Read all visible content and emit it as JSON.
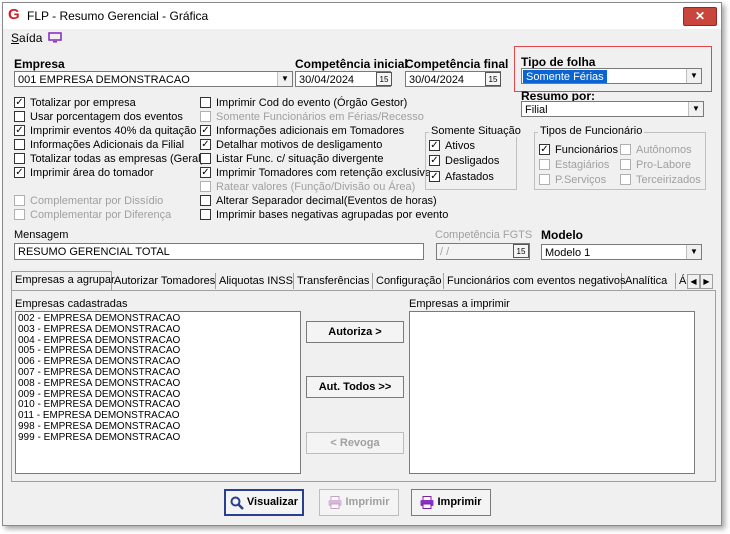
{
  "window": {
    "title": "FLP - Resumo Gerencial - Gráfica",
    "close_label": "✕"
  },
  "menu": {
    "saida_u": "S",
    "saida_rest": "aída"
  },
  "empresa": {
    "label": "Empresa",
    "value": "001 EMPRESA DEMONSTRACAO"
  },
  "competencia_inicial": {
    "label": "Competência inicial",
    "value": "30/04/2024"
  },
  "competencia_final": {
    "label": "Competência final",
    "value": "30/04/2024"
  },
  "calendar_btn": "15",
  "tipo_folha": {
    "label": "Tipo de folha",
    "value": "Somente Férias"
  },
  "resumo_por": {
    "label": "Resumo por:",
    "value": "Filial"
  },
  "checks_col1": [
    {
      "label": "Totalizar por empresa",
      "checked": true,
      "enabled": true
    },
    {
      "label": "Usar porcentagem dos eventos",
      "checked": false,
      "enabled": true
    },
    {
      "label": "Imprimir eventos 40% da quitação",
      "checked": true,
      "enabled": true
    },
    {
      "label": "Informações Adicionais da Filial",
      "checked": false,
      "enabled": true
    },
    {
      "label": "Totalizar todas as empresas (Geral)",
      "checked": false,
      "enabled": true
    },
    {
      "label": "Imprimir área do tomador",
      "checked": true,
      "enabled": true
    },
    {
      "label": "Complementar por Dissídio",
      "checked": false,
      "enabled": false
    },
    {
      "label": "Complementar por Diferença",
      "checked": false,
      "enabled": false
    }
  ],
  "checks_col2": [
    {
      "label": "Imprimir Cod do evento (Órgão Gestor)",
      "checked": false,
      "enabled": true
    },
    {
      "label": "Somente Funcionários em Férias/Recesso",
      "checked": false,
      "enabled": false
    },
    {
      "label": "Informações adicionais em Tomadores",
      "checked": true,
      "enabled": true
    },
    {
      "label": "Detalhar motivos de desligamento",
      "checked": true,
      "enabled": true
    },
    {
      "label": "Listar Func. c/ situação divergente",
      "checked": false,
      "enabled": true
    },
    {
      "label": "Imprimir Tomadores com retenção exclusiva",
      "checked": true,
      "enabled": true
    },
    {
      "label": "Ratear valores (Função/Divisão ou Área)",
      "checked": false,
      "enabled": false
    },
    {
      "label": "Alterar Separador decimal(Eventos de horas)",
      "checked": false,
      "enabled": true
    },
    {
      "label": "Imprimir bases negativas agrupadas por evento",
      "checked": false,
      "enabled": true
    }
  ],
  "somente_situacao": {
    "title": "Somente Situação",
    "items": [
      {
        "label": "Ativos",
        "checked": true
      },
      {
        "label": "Desligados",
        "checked": true
      },
      {
        "label": "Afastados",
        "checked": true
      }
    ]
  },
  "tipos_funcionario": {
    "title": "Tipos de Funcionário",
    "items": [
      {
        "label": "Funcionários",
        "checked": true,
        "enabled": true
      },
      {
        "label": "Autônomos",
        "checked": false,
        "enabled": false
      },
      {
        "label": "Estagiários",
        "checked": false,
        "enabled": false
      },
      {
        "label": "Pro-Labore",
        "checked": false,
        "enabled": false
      },
      {
        "label": "P.Serviços",
        "checked": false,
        "enabled": false
      },
      {
        "label": "Terceirizados",
        "checked": false,
        "enabled": false
      }
    ]
  },
  "mensagem": {
    "label": "Mensagem",
    "value": "RESUMO GERENCIAL TOTAL"
  },
  "competencia_fgts": {
    "label": "Competência FGTS",
    "value": " / /"
  },
  "modelo": {
    "label": "Modelo",
    "value": "Modelo 1"
  },
  "tabs": [
    "Empresas a agrupar",
    "Autorizar Tomadores",
    "Aliquotas INSS",
    "Transferências",
    "Configuração",
    "Funcionários com eventos negativos",
    "Analítica",
    "Ár"
  ],
  "empresas_cadastradas": {
    "label": "Empresas cadastradas",
    "items": [
      "002 - EMPRESA DEMONSTRACAO",
      "003 - EMPRESA DEMONSTRACAO",
      "004 - EMPRESA DEMONSTRACAO",
      "005 - EMPRESA DEMONSTRACAO",
      "006 - EMPRESA DEMONSTRACAO",
      "007 - EMPRESA DEMONSTRACAO",
      "008 - EMPRESA DEMONSTRACAO",
      "009 - EMPRESA DEMONSTRACAO",
      "010 - EMPRESA DEMONSTRACAO",
      "011 - EMPRESA DEMONSTRACAO",
      "998 - EMPRESA DEMONSTRACAO",
      "999 - EMPRESA DEMONSTRACAO"
    ]
  },
  "empresas_imprimir": {
    "label": "Empresas a imprimir",
    "items": []
  },
  "buttons": {
    "autoriza": "Autoriza >",
    "aut_todos": "Aut. Todos >>",
    "revoga": "< Revoga",
    "visualizar": "Visualizar",
    "imprimir_disabled": "Imprimir",
    "imprimir": "Imprimir"
  },
  "colors": {
    "accent": "#d0202a",
    "selection": "#0a64d2",
    "highlight_border": "#e0474c"
  }
}
